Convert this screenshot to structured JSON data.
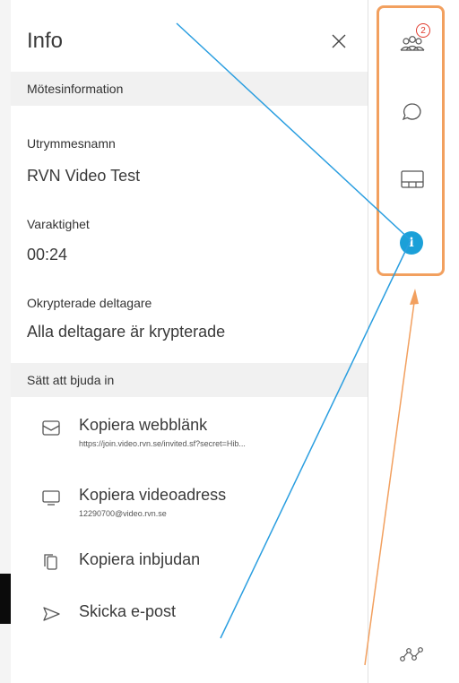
{
  "panel": {
    "title": "Info",
    "sections": {
      "meeting_info": "Mötesinformation",
      "invite_ways": "Sätt att bjuda in"
    },
    "fields": [
      {
        "label": "Utrymmesnamn",
        "value": "RVN Video Test"
      },
      {
        "label": "Varaktighet",
        "value": "00:24"
      },
      {
        "label": "Okrypterade deltagare",
        "value": "Alla deltagare är krypterade"
      }
    ],
    "invite_items": [
      {
        "icon": "envelope-icon",
        "title": "Kopiera webblänk",
        "subtitle": "https://join.video.rvn.se/invited.sf?secret=Hib..."
      },
      {
        "icon": "monitor-icon",
        "title": "Kopiera videoadress",
        "subtitle": "12290700@video.rvn.se"
      },
      {
        "icon": "copy-icon",
        "title": "Kopiera inbjudan",
        "subtitle": ""
      },
      {
        "icon": "send-icon",
        "title": "Skicka e-post",
        "subtitle": ""
      }
    ]
  },
  "sidebar": {
    "participants_badge": "2",
    "info_glyph": "i",
    "buttons": [
      "participants-icon",
      "chat-icon",
      "layout-icon",
      "info-icon"
    ]
  },
  "colors": {
    "highlight_box": "#f2a05f",
    "info_blue": "#1ba0d8",
    "badge_red": "#e03a2d",
    "annotation_blue": "#2a9ee0",
    "annotation_orange": "#f2a05f"
  }
}
